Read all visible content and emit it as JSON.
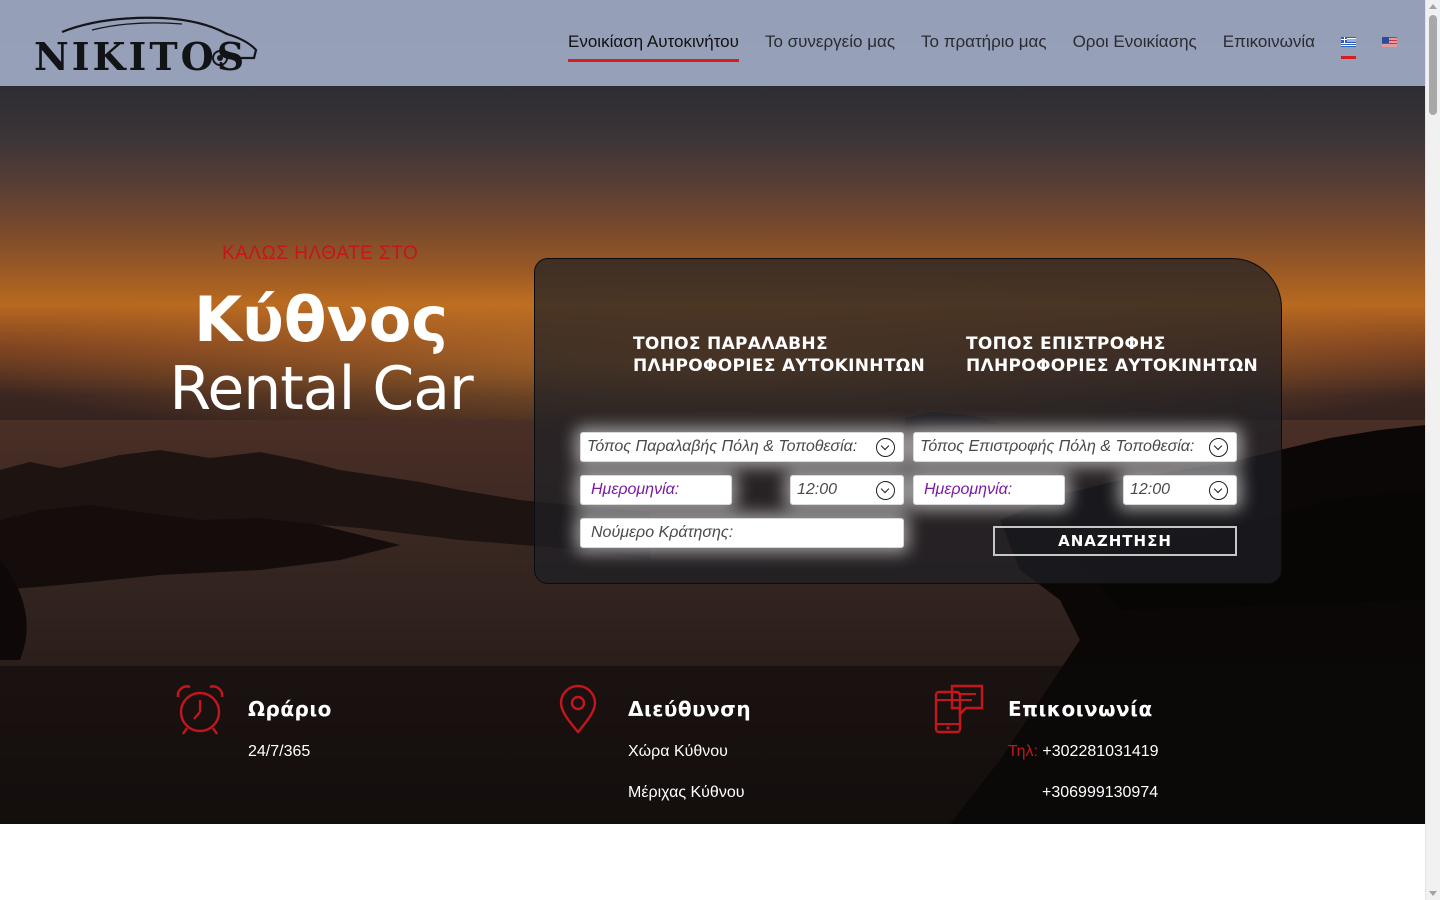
{
  "header": {
    "logo_text": "NIKITOS",
    "nav": [
      {
        "label": "Ενοικίαση Αυτοκινήτου",
        "active": true
      },
      {
        "label": "Το συνεργείο μας",
        "active": false
      },
      {
        "label": "Το πρατήριο μας",
        "active": false
      },
      {
        "label": "Οροι Ενοικίασης",
        "active": false
      },
      {
        "label": "Επικοινωνία",
        "active": false
      }
    ],
    "languages": [
      {
        "icon": "greek-flag-icon",
        "active": true
      },
      {
        "icon": "us-flag-icon",
        "active": false
      }
    ]
  },
  "hero": {
    "welcome": "ΚΑΛΩΣ ΗΛΘΑΤΕ ΣΤΟ",
    "title_line1": "Κύθνος",
    "title_line2": "Rental Car"
  },
  "booking": {
    "pickup_heading_1": "ΤΟΠΟΣ ΠΑΡΑΛΑΒΗΣ",
    "pickup_heading_2": "ΠΛΗΡΟΦΟΡΙΕΣ ΑΥΤΟΚΙΝΗΤΩΝ",
    "return_heading_1": "ΤΟΠΟΣ ΕΠΙΣΤΡΟΦΗΣ",
    "return_heading_2": "ΠΛΗΡΟΦΟΡΙΕΣ ΑΥΤΟΚΙΝΗΤΩΝ",
    "pickup_location_placeholder": "Τόπος Παραλαβής Πόλη & Τοποθεσία:",
    "return_location_placeholder": "Τόπος Επιστροφής Πόλη & Τοποθεσία:",
    "pickup_date_placeholder": "Ημερομηνία:",
    "pickup_time": "12:00",
    "return_date_placeholder": "Ημερομηνία:",
    "return_time": "12:00",
    "reservation_placeholder": "Νούμερο Κράτησης:",
    "search_label": "ΑΝΑΖΗΤΗΣΗ"
  },
  "info": {
    "hours": {
      "icon": "alarm-clock-icon",
      "title": "Ωράριο",
      "text": "24/7/365"
    },
    "address": {
      "icon": "map-pin-icon",
      "title": "Διεύθυνση",
      "line1": "Χώρα Κύθνου",
      "line2": "Μέριχας Κύθνου"
    },
    "contact": {
      "icon": "phone-chat-icon",
      "title": "Επικοινωνία",
      "label": "Τηλ:",
      "phone1": "+302281031419",
      "phone2": "+306999130974"
    }
  },
  "colors": {
    "accent": "#c4161c",
    "header_bg": "#a0aac4",
    "booking_bg": "#1e2026"
  }
}
